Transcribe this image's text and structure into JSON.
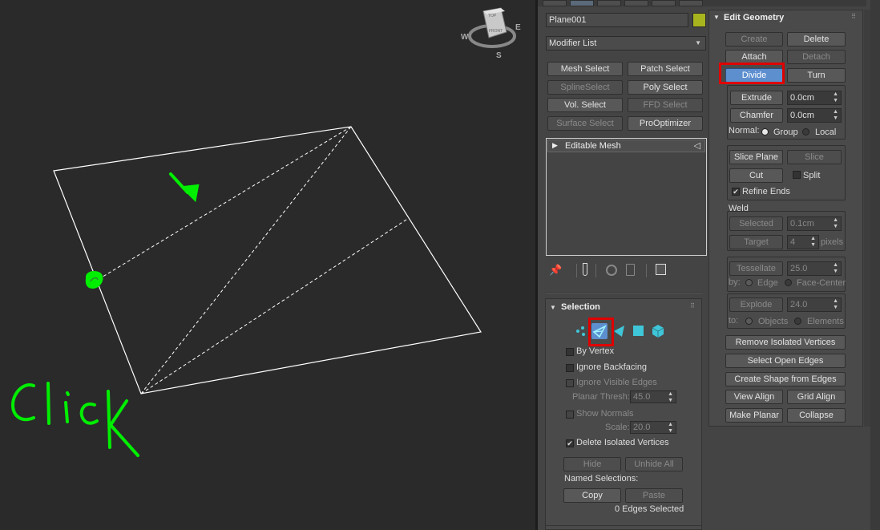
{
  "viewport": {
    "viewcube": {
      "top": "TOP",
      "front": "FRONT",
      "west": "W",
      "east": "E",
      "south": "S"
    },
    "annotation_text": "Click"
  },
  "object": {
    "name": "Plane001",
    "color": "#a8b41e"
  },
  "modifier_list": {
    "label": "Modifier List"
  },
  "modifier_buttons": {
    "mesh_select": "Mesh Select",
    "patch_select": "Patch Select",
    "spline_select": "SplineSelect",
    "poly_select": "Poly Select",
    "vol_select": "Vol. Select",
    "ffd_select": "FFD Select",
    "surface_select": "Surface Select",
    "pro_optimizer": "ProOptimizer"
  },
  "stack": {
    "item": "Editable Mesh"
  },
  "selection": {
    "title": "Selection",
    "by_vertex": "By Vertex",
    "ignore_backfacing": "Ignore Backfacing",
    "ignore_visible_edges": "Ignore Visible Edges",
    "planar_thresh_label": "Planar Thresh:",
    "planar_thresh_value": "45.0",
    "show_normals": "Show Normals",
    "scale_label": "Scale:",
    "scale_value": "20.0",
    "delete_isolated": "Delete Isolated Vertices",
    "hide": "Hide",
    "unhide_all": "Unhide All",
    "named_selections": "Named Selections:",
    "copy": "Copy",
    "paste": "Paste",
    "status": "0 Edges Selected"
  },
  "edit_geometry": {
    "title": "Edit Geometry",
    "create": "Create",
    "delete": "Delete",
    "attach": "Attach",
    "detach": "Detach",
    "divide": "Divide",
    "turn": "Turn",
    "extrude": "Extrude",
    "extrude_value": "0.0cm",
    "chamfer": "Chamfer",
    "chamfer_value": "0.0cm",
    "normal_label": "Normal:",
    "group": "Group",
    "local": "Local",
    "slice_plane": "Slice Plane",
    "slice": "Slice",
    "cut": "Cut",
    "split": "Split",
    "refine_ends": "Refine Ends",
    "weld_label": "Weld",
    "weld_selected": "Selected",
    "weld_selected_value": "0.1cm",
    "weld_target": "Target",
    "weld_target_value": "4",
    "pixels": "pixels",
    "tessellate": "Tessellate",
    "tessellate_value": "25.0",
    "by_label": "by:",
    "edge": "Edge",
    "face_center": "Face-Center",
    "explode": "Explode",
    "explode_value": "24.0",
    "to_label": "to:",
    "objects": "Objects",
    "elements": "Elements",
    "remove_isolated": "Remove Isolated Vertices",
    "select_open_edges": "Select Open Edges",
    "create_shape": "Create Shape from Edges",
    "view_align": "View Align",
    "grid_align": "Grid Align",
    "make_planar": "Make Planar",
    "collapse": "Collapse"
  },
  "colors": {
    "highlight": "#e00000",
    "annotation": "#00ee00",
    "active_button": "#5d8fcf",
    "selection_icons": "#3fc6d8"
  }
}
